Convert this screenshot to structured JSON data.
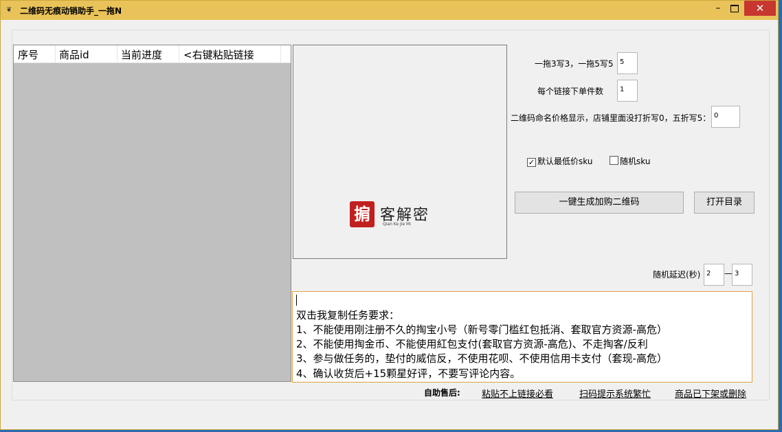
{
  "window": {
    "title": "二维码无痕动销助手_一拖N",
    "icon": "app-icon",
    "controls": {
      "minimize": "–",
      "close": "✕"
    }
  },
  "list": {
    "columns": [
      "序号",
      "商品id",
      "当前进度",
      "<右键粘贴链接"
    ],
    "rows": []
  },
  "preview": {
    "logo_mark": "掮",
    "logo_text": "客解密",
    "logo_sub": "Qian Ke Jie Mi"
  },
  "settings": {
    "drag_label": "一拖3写3，一拖5写5",
    "drag_value": "5",
    "orders_label": "每个链接下单件数",
    "orders_value": "1",
    "price_label": "二维码命名价格显示，店铺里面没打折写0，五折写5：",
    "price_value": "0",
    "default_sku_label": "默认最低价sku",
    "default_sku_checked": true,
    "random_sku_label": "随机sku",
    "random_sku_checked": false,
    "generate_button": "一键生成加购二维码",
    "open_dir_button": "打开目录",
    "delay_label": "随机延迟(秒)",
    "delay_min": "2",
    "delay_sep": "—",
    "delay_max": "3"
  },
  "task": {
    "lines": [
      "双击我复制任务要求：",
      "1、不能使用刚注册不久的掏宝小号（新号零门槛红包抵消、套取官方资源-高危）",
      "2、不能使用掏金币、不能使用紅包支付(套取官方资源-高危)、不走掏客/反利",
      "3、参与做任务的，垫付的威信反，不使用花呗、不使用信用卡支付（套现-高危）",
      "4、确认收货后+15颗星好评，不要写评论内容。"
    ]
  },
  "footer": {
    "label": "自助售后:",
    "links": [
      "粘贴不上链接必看",
      "扫码提示系统繁忙",
      "商品已下架或删除"
    ]
  }
}
